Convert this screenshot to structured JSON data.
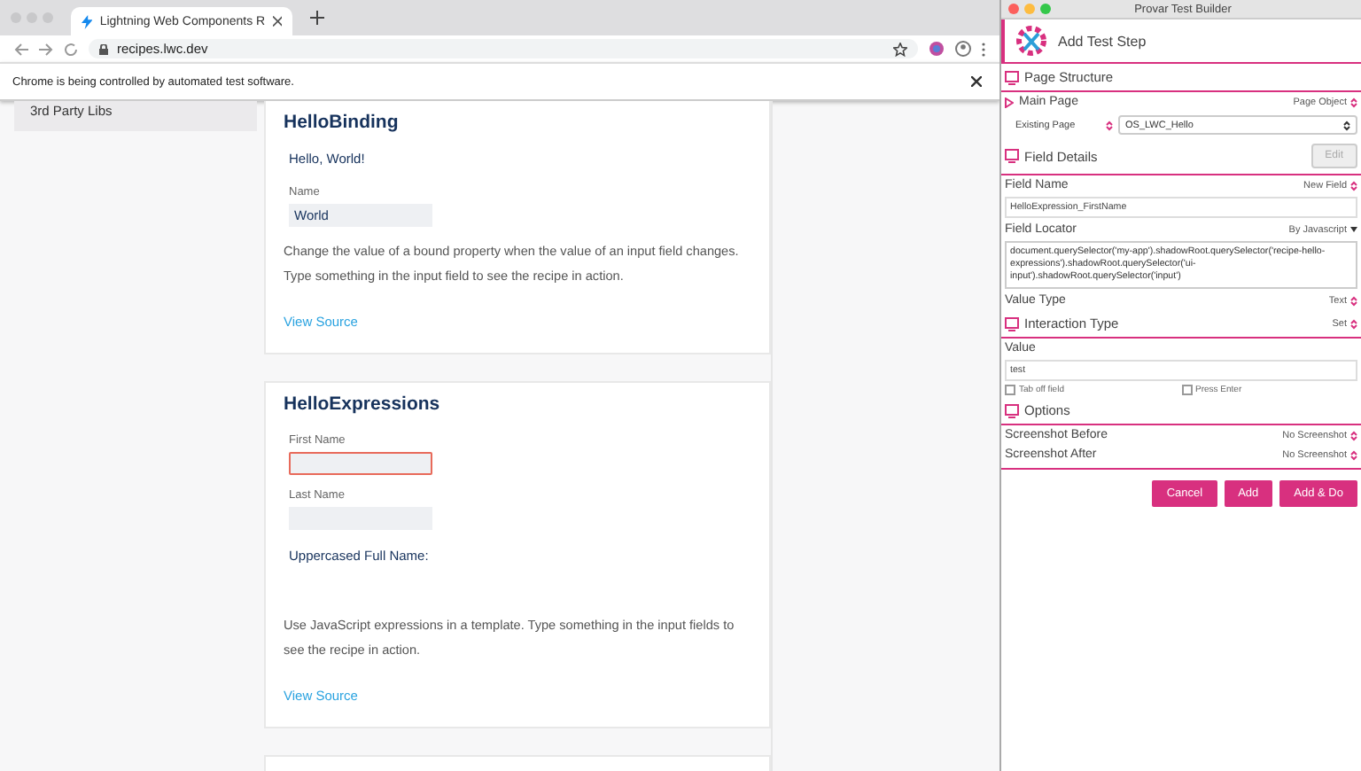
{
  "browser": {
    "tab": {
      "title": "Lightning Web Components R",
      "selected": true
    },
    "url": "recipes.lwc.dev",
    "infobar": "Chrome is being controlled by automated test software."
  },
  "sidebar": {
    "items": [
      {
        "label": "3rd Party Libs",
        "selected": false
      }
    ]
  },
  "cards": [
    {
      "kind": "binding",
      "title": "HelloBinding",
      "greeting": "Hello, World!",
      "fields": [
        {
          "label": "Name",
          "value": "World",
          "focused": false
        }
      ],
      "description": "Change the value of a bound property when the value of an input field changes. Type something in the input field to see the recipe in action.",
      "link": "View Source"
    },
    {
      "kind": "expressions",
      "title": "HelloExpressions",
      "fields": [
        {
          "label": "First Name",
          "focused": true
        },
        {
          "label": "Last Name",
          "focused": false
        }
      ],
      "result": "Uppercased Full Name:",
      "description": "Use JavaScript expressions in a template. Type something in the input fields to see the recipe in action.",
      "link": "View Source"
    }
  ],
  "panel": {
    "window_title": "Provar Test Builder",
    "header": "Add Test Step",
    "rows": [
      {
        "kind": "section",
        "label": "Page Structure"
      },
      {
        "kind": "select",
        "label": "Main Page",
        "value": "Page Object",
        "arrow": true
      },
      {
        "kind": "dropdown",
        "label": "Existing Page",
        "value": "OS_LWC_Hello"
      },
      {
        "kind": "section",
        "label": "Field Details",
        "button": "Edit",
        "disabled": true
      },
      {
        "kind": "select",
        "label": "Field Name",
        "value": "New Field"
      },
      {
        "kind": "input",
        "value": "HelloExpression_FirstName"
      },
      {
        "kind": "select",
        "label": "Field Locator",
        "value": "By Javascript",
        "caret": true
      },
      {
        "kind": "textarea",
        "value": "document.querySelector('my-app').shadowRoot.querySelector('recipe-hello-expressions').shadowRoot.querySelector('ui-input').shadowRoot.querySelector('input')"
      },
      {
        "kind": "select",
        "label": "Value Type",
        "value": "Text"
      },
      {
        "kind": "section",
        "label": "Interaction Type",
        "value": "Set"
      },
      {
        "kind": "label",
        "label": "Value"
      },
      {
        "kind": "input",
        "value": "test"
      },
      {
        "kind": "checks",
        "items": [
          {
            "label": "Tab off field",
            "checked": false
          },
          {
            "label": "Press Enter",
            "checked": false
          }
        ]
      },
      {
        "kind": "section",
        "label": "Options"
      },
      {
        "kind": "select",
        "label": "Screenshot Before",
        "value": "No Screenshot"
      },
      {
        "kind": "select",
        "label": "Screenshot After",
        "value": "No Screenshot",
        "rule": true
      }
    ],
    "buttons": [
      "Cancel",
      "Add",
      "Add & Do"
    ]
  }
}
